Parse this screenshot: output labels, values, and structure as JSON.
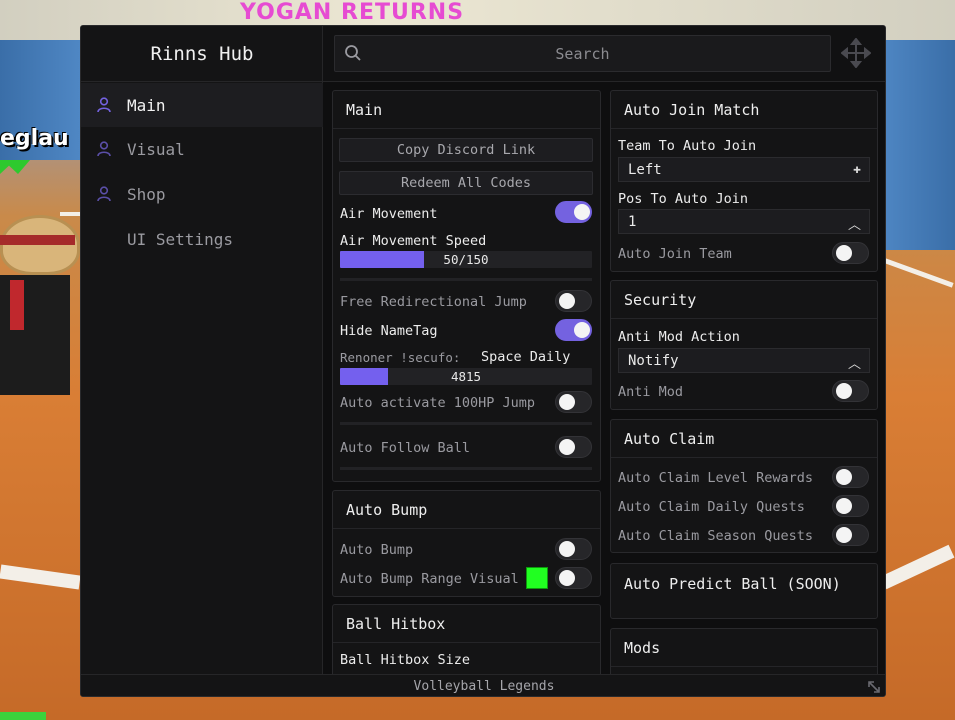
{
  "app": {
    "title": "Rinns Hub",
    "footer": "Volleyball Legends",
    "accent": "#7462e0"
  },
  "background": {
    "banner": "YOGAN RETURNS",
    "player_name": "eglau"
  },
  "sidebar": {
    "items": [
      {
        "label": "Main",
        "icon": "user-icon",
        "active": true
      },
      {
        "label": "Visual",
        "icon": "user-icon",
        "active": false
      },
      {
        "label": "Shop",
        "icon": "user-icon",
        "active": false
      },
      {
        "label": "UI Settings",
        "icon": "",
        "active": false
      }
    ]
  },
  "search": {
    "placeholder": "Search"
  },
  "main_panel": {
    "title": "Main",
    "copy_discord": "Copy Discord Link",
    "redeem_codes": "Redeem All Codes",
    "air_movement": {
      "label": "Air Movement",
      "on": true
    },
    "air_speed": {
      "label": "Air Movement Speed",
      "value": 50,
      "max": 150,
      "text": "50/150"
    },
    "free_jump": {
      "label": "Free Redirectional Jump",
      "on": false
    },
    "hide_nametag": {
      "label": "Hide NameTag",
      "on": true
    },
    "space_daily": {
      "label_ghost": "Renoner !secufo:",
      "label": "Space Daily",
      "text": "4815",
      "fill_fraction": 0.19
    },
    "auto_100hp": {
      "label": "Auto activate 100HP Jump",
      "on": false
    },
    "auto_follow": {
      "label": "Auto Follow Ball",
      "on": false
    }
  },
  "auto_bump_panel": {
    "title": "Auto Bump",
    "auto_bump": {
      "label": "Auto Bump",
      "on": false
    },
    "range_visual": {
      "label": "Auto Bump Range Visual",
      "on": false,
      "color": "#21ff21"
    }
  },
  "ball_hitbox_panel": {
    "title": "Ball Hitbox",
    "size_label": "Ball Hitbox Size"
  },
  "auto_join_panel": {
    "title": "Auto Join Match",
    "team_label": "Team To Auto Join",
    "team_value": "Left",
    "pos_label": "Pos To Auto Join",
    "pos_value": "1",
    "auto_join_team": {
      "label": "Auto Join Team",
      "on": false
    }
  },
  "security_panel": {
    "title": "Security",
    "action_label": "Anti Mod Action",
    "action_value": "Notify",
    "anti_mod": {
      "label": "Anti Mod",
      "on": false
    }
  },
  "auto_claim_panel": {
    "title": "Auto Claim",
    "level": {
      "label": "Auto Claim Level Rewards",
      "on": false
    },
    "daily": {
      "label": "Auto Claim Daily Quests",
      "on": false
    },
    "season": {
      "label": "Auto Claim Season Quests",
      "on": false
    }
  },
  "predict_panel": {
    "title": "Auto Predict Ball (SOON)"
  },
  "mods_panel": {
    "title": "Mods"
  }
}
